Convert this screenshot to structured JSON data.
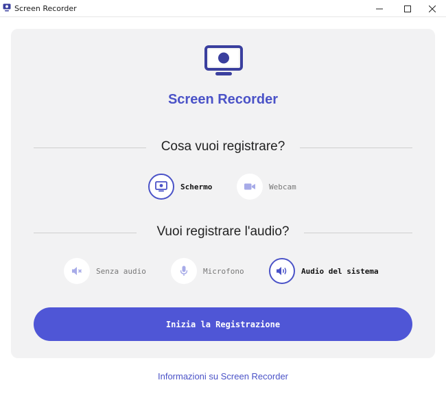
{
  "window": {
    "title": "Screen Recorder",
    "controls": [
      "minimize-icon",
      "maximize-icon",
      "close-icon"
    ]
  },
  "app": {
    "title": "Screen Recorder",
    "accent_color": "#4a52c7",
    "button_color": "#4f56d6"
  },
  "source_section": {
    "heading": "Cosa vuoi registrare?",
    "options": [
      {
        "label": "Schermo",
        "icon": "monitor-icon",
        "selected": true
      },
      {
        "label": "Webcam",
        "icon": "video-camera-icon",
        "selected": false
      }
    ]
  },
  "audio_section": {
    "heading": "Vuoi registrare l'audio?",
    "options": [
      {
        "label": "Senza audio",
        "icon": "speaker-muted-icon",
        "selected": false
      },
      {
        "label": "Microfono",
        "icon": "microphone-icon",
        "selected": false
      },
      {
        "label": "Audio del sistema",
        "icon": "speaker-volume-icon",
        "selected": true
      }
    ]
  },
  "start_button": {
    "label": "Inizia la Registrazione"
  },
  "about_link": {
    "label": "Informazioni su Screen Recorder"
  }
}
